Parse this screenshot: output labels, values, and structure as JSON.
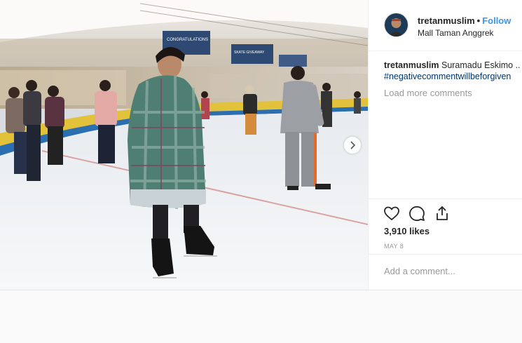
{
  "post": {
    "username": "tretanmuslim",
    "separator": "•",
    "follow_label": "Follow",
    "location": "Mall Taman Anggrek",
    "caption_user": "tretanmuslim",
    "caption_text": "Suramadu Eskimo ..",
    "hashtag": "#negativecommentwillbeforgiven",
    "load_more": "Load more comments",
    "likes": "3,910 likes",
    "date": "MAY 8",
    "comment_placeholder": "Add a comment..."
  },
  "photo": {
    "banner_texts": [
      "CONGRATULATIONS",
      "SKATE GIVEAWAY"
    ]
  },
  "icons": {
    "like": "heart-icon",
    "comment": "comment-bubble-icon",
    "share": "share-icon",
    "next": "chevron-right-icon"
  },
  "colors": {
    "follow": "#3897f0",
    "hashtag": "#003569",
    "muted": "#999999",
    "text": "#262626"
  }
}
